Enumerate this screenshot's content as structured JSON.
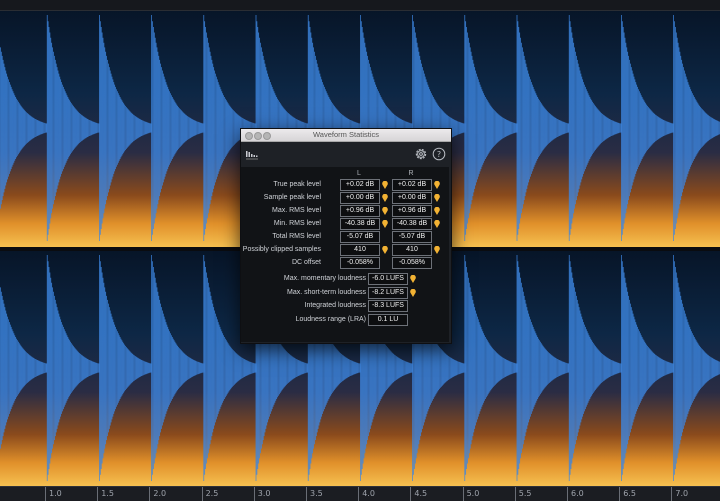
{
  "dialog": {
    "title": "Waveform Statistics",
    "col_left": "L",
    "col_right": "R"
  },
  "channel_stats": [
    {
      "label": "True peak level",
      "left": "+0.02 dB",
      "right": "+0.02 dB",
      "marker_left": true,
      "marker_right": true
    },
    {
      "label": "Sample peak level",
      "left": "+0.00 dB",
      "right": "+0.00 dB",
      "marker_left": true,
      "marker_right": true
    },
    {
      "label": "Max. RMS level",
      "left": "+0.96 dB",
      "right": "+0.96 dB",
      "marker_left": true,
      "marker_right": true
    },
    {
      "label": "Min. RMS level",
      "left": "-40.38 dB",
      "right": "-40.38 dB",
      "marker_left": true,
      "marker_right": true
    },
    {
      "label": "Total RMS level",
      "left": "-5.07 dB",
      "right": "-5.07 dB",
      "marker_left": false,
      "marker_right": false
    },
    {
      "label": "Possibly clipped samples",
      "left": "410",
      "right": "410",
      "marker_left": true,
      "marker_right": true
    },
    {
      "label": "DC offset",
      "left": "-0.058%",
      "right": "-0.058%",
      "marker_left": false,
      "marker_right": false
    }
  ],
  "loudness_stats": [
    {
      "label": "Max. momentary loudness",
      "value": "-6.0 LUFS",
      "marker": true
    },
    {
      "label": "Max. short-term loudness",
      "value": "-8.2 LUFS",
      "marker": true
    },
    {
      "label": "Integrated loudness",
      "value": "-8.3 LUFS",
      "marker": false
    },
    {
      "label": "Loudness range (LRA)",
      "value": "0.1 LU",
      "marker": false
    }
  ],
  "timeline": {
    "ticks": [
      "1.0",
      "1.5",
      "2.0",
      "2.5",
      "3.0",
      "3.5",
      "4.0",
      "4.5",
      "5.0",
      "5.5",
      "6.0",
      "6.5",
      "7.0"
    ]
  },
  "colors": {
    "waveform": "#3d86e0",
    "spectrogram_hot": "#f0a030",
    "marker": "#f2b233"
  },
  "icons": {
    "logo": "app-logo-icon",
    "settings": "gear-icon",
    "help": "help-icon",
    "marker": "location-marker-icon"
  }
}
